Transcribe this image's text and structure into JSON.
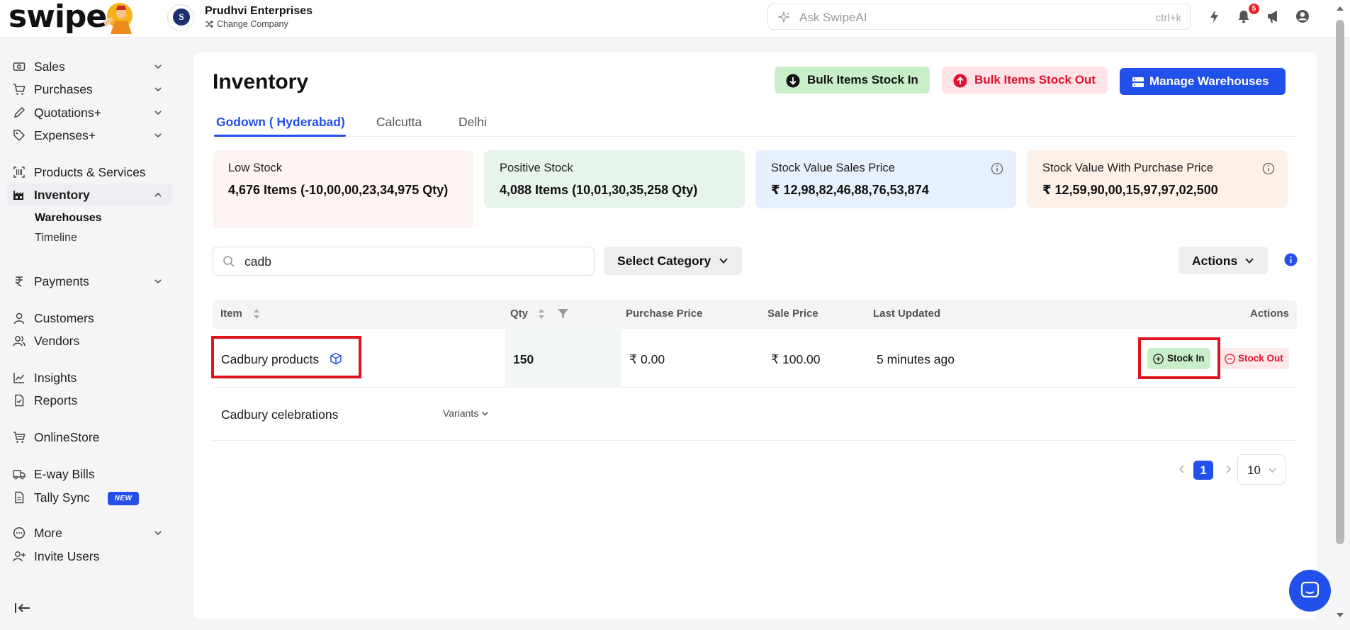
{
  "app": {
    "logo_text": "swipe"
  },
  "company": {
    "name": "Prudhvi Enterprises",
    "change_label": "Change Company",
    "logo_letter": "S"
  },
  "search_ai": {
    "placeholder": "Ask SwipeAI",
    "shortcut": "ctrl+k"
  },
  "notifications": {
    "count": "5"
  },
  "sidebar": {
    "items": [
      {
        "label": "Sales"
      },
      {
        "label": "Purchases"
      },
      {
        "label": "Quotations+"
      },
      {
        "label": "Expenses+"
      },
      {
        "label": "Products & Services"
      },
      {
        "label": "Inventory"
      },
      {
        "label": "Payments"
      },
      {
        "label": "Customers"
      },
      {
        "label": "Vendors"
      },
      {
        "label": "Insights"
      },
      {
        "label": "Reports"
      },
      {
        "label": "OnlineStore"
      },
      {
        "label": "E-way Bills"
      },
      {
        "label": "Tally Sync"
      },
      {
        "label": "More"
      },
      {
        "label": "Invite Users"
      }
    ],
    "inventory_sub": [
      "Warehouses",
      "Timeline"
    ],
    "new_badge": "NEW"
  },
  "page": {
    "title": "Inventory",
    "buttons": {
      "bulk_in": "Bulk Items Stock In",
      "bulk_out": "Bulk Items Stock Out",
      "manage_warehouses": "Manage Warehouses"
    },
    "tabs": [
      "Godown ( Hyderabad)",
      "Calcutta",
      "Delhi"
    ],
    "active_tab": "Godown ( Hyderabad)"
  },
  "stats": [
    {
      "label": "Low Stock",
      "value": "4,676 Items (-10,00,00,23,34,975 Qty)",
      "bg": "#fdf3f2"
    },
    {
      "label": "Positive Stock",
      "value": "4,088 Items (10,01,30,35,258 Qty)",
      "bg": "#e7f4ec"
    },
    {
      "label": "Stock Value Sales Price",
      "value": "₹ 12,98,82,46,88,76,53,874",
      "bg": "#e7f0fd"
    },
    {
      "label": "Stock Value With Purchase Price",
      "value": "₹ 12,59,90,00,15,97,97,02,500",
      "bg": "#fdf0e7"
    }
  ],
  "filters": {
    "search_value": "cadb",
    "category_label": "Select Category",
    "actions_label": "Actions"
  },
  "table": {
    "headers": {
      "item": "Item",
      "qty": "Qty",
      "purchase_price": "Purchase Price",
      "sale_price": "Sale Price",
      "last_updated": "Last Updated",
      "actions": "Actions"
    },
    "rows": [
      {
        "item": "Cadbury products",
        "qty": "150",
        "purchase_price": "₹ 0.00",
        "sale_price": "₹ 100.00",
        "last_updated": "5 minutes ago",
        "stock_in": "Stock In",
        "stock_out": "Stock Out"
      },
      {
        "item": "Cadbury celebrations",
        "variants_label": "Variants"
      }
    ]
  },
  "pagination": {
    "current_page": "1",
    "page_size": "10"
  },
  "colors": {
    "accent": "#2150ea",
    "danger": "#e0102e",
    "success_bg": "#c8efc9",
    "highlight": "#e0141e"
  }
}
